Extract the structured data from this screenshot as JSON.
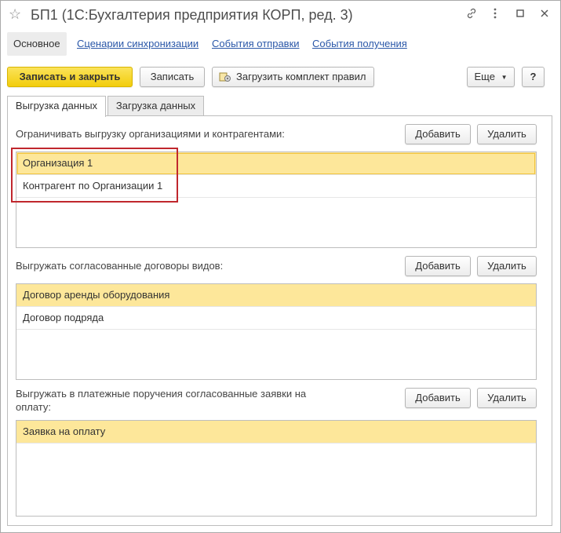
{
  "window": {
    "title": "БП1 (1С:Бухгалтерия предприятия КОРП, ред. 3)",
    "icons": [
      "star-icon",
      "link-icon",
      "more-icon",
      "minimize-icon",
      "maximize-icon",
      "close-icon"
    ]
  },
  "nav": {
    "items": [
      {
        "label": "Основное"
      },
      {
        "label": "Сценарии синхронизации"
      },
      {
        "label": "События отправки"
      },
      {
        "label": "События получения"
      }
    ]
  },
  "toolbar": {
    "save_close_label": "Записать и закрыть",
    "save_label": "Записать",
    "load_rules_label": "Загрузить комплект правил",
    "more_label": "Еще",
    "help_label": "?"
  },
  "tabs": [
    {
      "label": "Выгрузка данных"
    },
    {
      "label": "Загрузка данных"
    }
  ],
  "sections": [
    {
      "label": "Ограничивать выгрузку организациями и контрагентами:",
      "add_label": "Добавить",
      "delete_label": "Удалить",
      "rows": [
        "Организация 1",
        "Контрагент по Организации 1"
      ]
    },
    {
      "label": "Выгружать согласованные договоры видов:",
      "add_label": "Добавить",
      "delete_label": "Удалить",
      "rows": [
        "Договор аренды оборудования",
        "Договор подряда"
      ]
    },
    {
      "label_line1": "Выгружать в платежные поручения согласованные заявки на",
      "label_line2": "оплату:",
      "add_label": "Добавить",
      "delete_label": "Удалить",
      "rows": [
        "Заявка на оплату"
      ]
    }
  ],
  "colors": {
    "primary_button": "#f2cd0c",
    "selected_row": "#fde79a",
    "link": "#2a57a8",
    "annotation_frame": "#c0272d"
  }
}
